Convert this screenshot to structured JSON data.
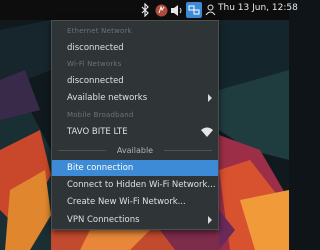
{
  "topbar": {
    "clock": "Thu 13 Jun, 12:58",
    "tray_icons": [
      "bluetooth-icon",
      "app-indicator-icon",
      "volume-icon",
      "network-icon",
      "user-icon"
    ]
  },
  "menu": {
    "ethernet_section": "Ethernet Network",
    "ethernet_status": "disconnected",
    "wifi_section": "Wi-Fi Networks",
    "wifi_status": "disconnected",
    "available_networks": "Available networks",
    "mobile_section": "Mobile Broadband",
    "mobile_name": "TAVO BITE LTE",
    "available_label": "Available",
    "bite_connection": "Bite connection",
    "connect_hidden": "Connect to Hidden Wi-Fi Network...",
    "create_new": "Create New Wi-Fi Network...",
    "vpn": "VPN Connections"
  },
  "colors": {
    "highlight": "#3d8bd6",
    "menu_bg": "#2f3436",
    "topbar_bg": "#0d0d0d"
  }
}
